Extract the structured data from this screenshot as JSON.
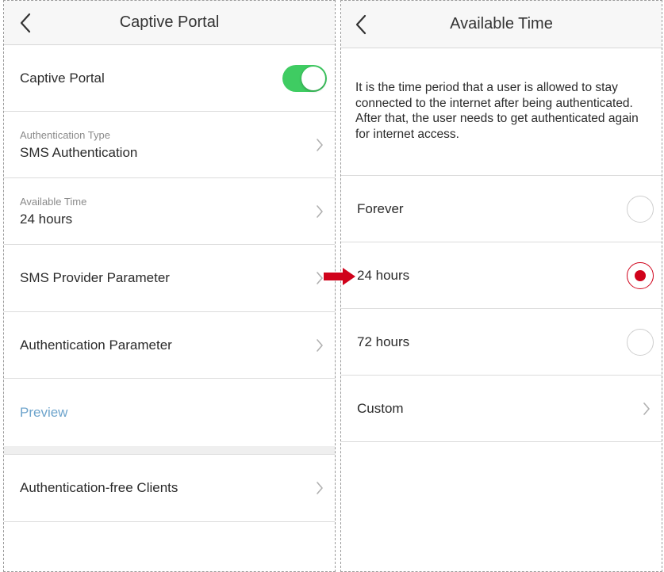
{
  "left": {
    "title": "Captive Portal",
    "captive_portal_label": "Captive Portal",
    "captive_portal_enabled": true,
    "auth_type": {
      "label": "Authentication Type",
      "value": "SMS Authentication"
    },
    "available_time": {
      "label": "Available Time",
      "value": "24 hours"
    },
    "sms_provider_label": "SMS Provider Parameter",
    "auth_param_label": "Authentication Parameter",
    "preview_label": "Preview",
    "auth_free_label": "Authentication-free Clients"
  },
  "right": {
    "title": "Available Time",
    "description": "It is the time period that a user is allowed to stay connected to the internet after being authenticated. After that, the user needs to get authenticated again for internet access.",
    "options": [
      {
        "label": "Forever",
        "selected": false
      },
      {
        "label": "24 hours",
        "selected": true
      },
      {
        "label": "72 hours",
        "selected": false
      }
    ],
    "custom_label": "Custom"
  },
  "colors": {
    "toggle_on": "#3fcc62",
    "radio_selected": "#d0021b",
    "preview_link": "#6ea4cc",
    "arrow": "#d0021b"
  },
  "icons": [
    "back-icon",
    "chevron-right-icon",
    "red-arrow-icon"
  ]
}
